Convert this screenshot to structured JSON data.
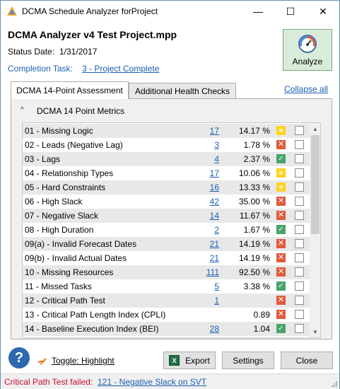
{
  "window": {
    "title": "DCMA Schedule Analyzer forProject",
    "min_glyph": "—",
    "max_glyph": "☐",
    "close_glyph": "✕"
  },
  "project": {
    "name": "DCMA Analyzer v4 Test Project.mpp",
    "status_date_label": "Status Date:",
    "status_date": "1/31/2017",
    "completion_task_label": "Completion Task:",
    "completion_task": "3 - Project Complete"
  },
  "analyze_button": {
    "label": "Analyze",
    "icon": "gauge-icon"
  },
  "tabs": [
    {
      "label": "DCMA 14-Point Assessment",
      "active": true
    },
    {
      "label": "Additional Health Checks",
      "active": false
    }
  ],
  "collapse_all": "Collapse all",
  "section": {
    "chevron": "^",
    "title": "DCMA 14 Point Metrics"
  },
  "metrics": [
    {
      "label": "01 - Missing Logic",
      "count": "17",
      "percent": "14.17 %",
      "status": "yellow"
    },
    {
      "label": "02 - Leads (Negative Lag)",
      "count": "3",
      "percent": "1.78 %",
      "status": "red"
    },
    {
      "label": "03 - Lags",
      "count": "4",
      "percent": "2.37 %",
      "status": "green"
    },
    {
      "label": "04 - Relationship Types",
      "count": "17",
      "percent": "10.06 %",
      "status": "yellow"
    },
    {
      "label": "05 - Hard Constraints",
      "count": "16",
      "percent": "13.33 %",
      "status": "yellow"
    },
    {
      "label": "06 - High Slack",
      "count": "42",
      "percent": "35.00 %",
      "status": "red"
    },
    {
      "label": "07 - Negative Slack",
      "count": "14",
      "percent": "11.67 %",
      "status": "red"
    },
    {
      "label": "08 - High Duration",
      "count": "2",
      "percent": "1.67 %",
      "status": "green"
    },
    {
      "label": "09(a) - Invalid Forecast Dates",
      "count": "21",
      "percent": "14.19 %",
      "status": "red"
    },
    {
      "label": "09(b) - Invalid Actual Dates",
      "count": "21",
      "percent": "14.19 %",
      "status": "red"
    },
    {
      "label": "10 - Missing Resources",
      "count": "111",
      "percent": "92.50 %",
      "status": "red"
    },
    {
      "label": "11 - Missed Tasks",
      "count": "5",
      "percent": "3.38 %",
      "status": "green"
    },
    {
      "label": "12 - Critical Path Test",
      "count": "1",
      "percent": "",
      "status": "red"
    },
    {
      "label": "13 - Critical Path Length Index (CPLI)",
      "count": "",
      "percent": "0.89",
      "status": "red"
    },
    {
      "label": "14 - Baseline Execution Index (BEI)",
      "count": "28",
      "percent": "1.04",
      "status": "green"
    }
  ],
  "status_colors": {
    "yellow": "#ffd21f",
    "red": "#e05a3c",
    "green": "#4aa36b"
  },
  "footer": {
    "help_glyph": "?",
    "toggle_label": "Toggle: Highlight",
    "export_label": "Export",
    "export_icon_glyph": "X",
    "settings_label": "Settings",
    "close_label": "Close"
  },
  "statusbar": {
    "message": "Critical Path Test failed:",
    "link": "121 - Negative Slack on SVT"
  }
}
